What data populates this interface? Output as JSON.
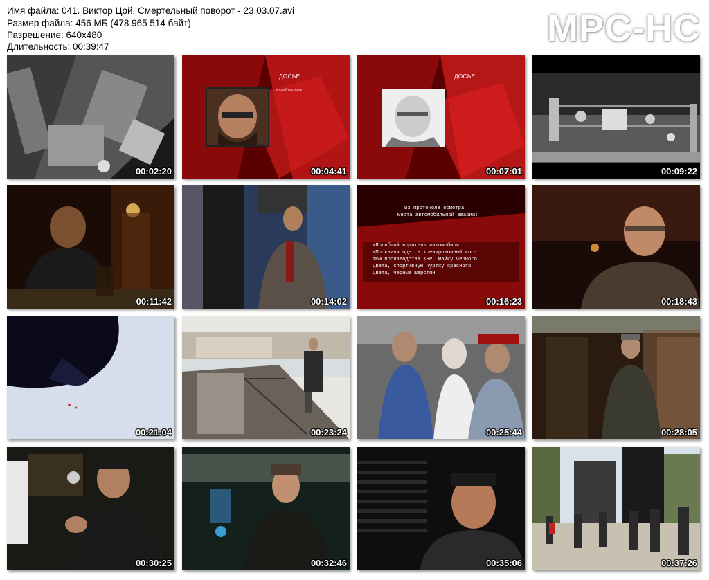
{
  "info": {
    "filename": "Имя файла: 041. Виктор Цой. Смертельный поворот - 23.03.07.avi",
    "filesize": "Размер файла: 456 МБ (478 965 514 байт)",
    "resolution": "Разрешение: 640x480",
    "duration": "Длительность: 00:39:47"
  },
  "logo": "MPC-HC",
  "thumbnails": [
    {
      "time": "00:02:20"
    },
    {
      "time": "00:04:41",
      "overlay_title": "ДОСЬЕ",
      "overlay_sub": "ЮРИЙ ШЕВЧУК"
    },
    {
      "time": "00:07:01",
      "overlay_title": "ДОСЬЕ"
    },
    {
      "time": "00:09:22"
    },
    {
      "time": "00:11:42"
    },
    {
      "time": "00:14:02"
    },
    {
      "time": "00:16:23",
      "protocol_head_1": "Из протокола осмотра",
      "protocol_head_2": "места автомобильной аварии:",
      "protocol_body_1": "«Погибший водитель автомобиля",
      "protocol_body_2": "«Москвич» одет в тренировочный кос-",
      "protocol_body_3": "тюм производства КНР, майку черного",
      "protocol_body_4": "цвета, спортивную куртку красного",
      "protocol_body_5": "цвета, черные шерстян"
    },
    {
      "time": "00:18:43"
    },
    {
      "time": "00:21:04"
    },
    {
      "time": "00:23:24"
    },
    {
      "time": "00:25:44"
    },
    {
      "time": "00:28:05"
    },
    {
      "time": "00:30:25"
    },
    {
      "time": "00:32:46"
    },
    {
      "time": "00:35:06"
    },
    {
      "time": "00:37:26"
    }
  ]
}
